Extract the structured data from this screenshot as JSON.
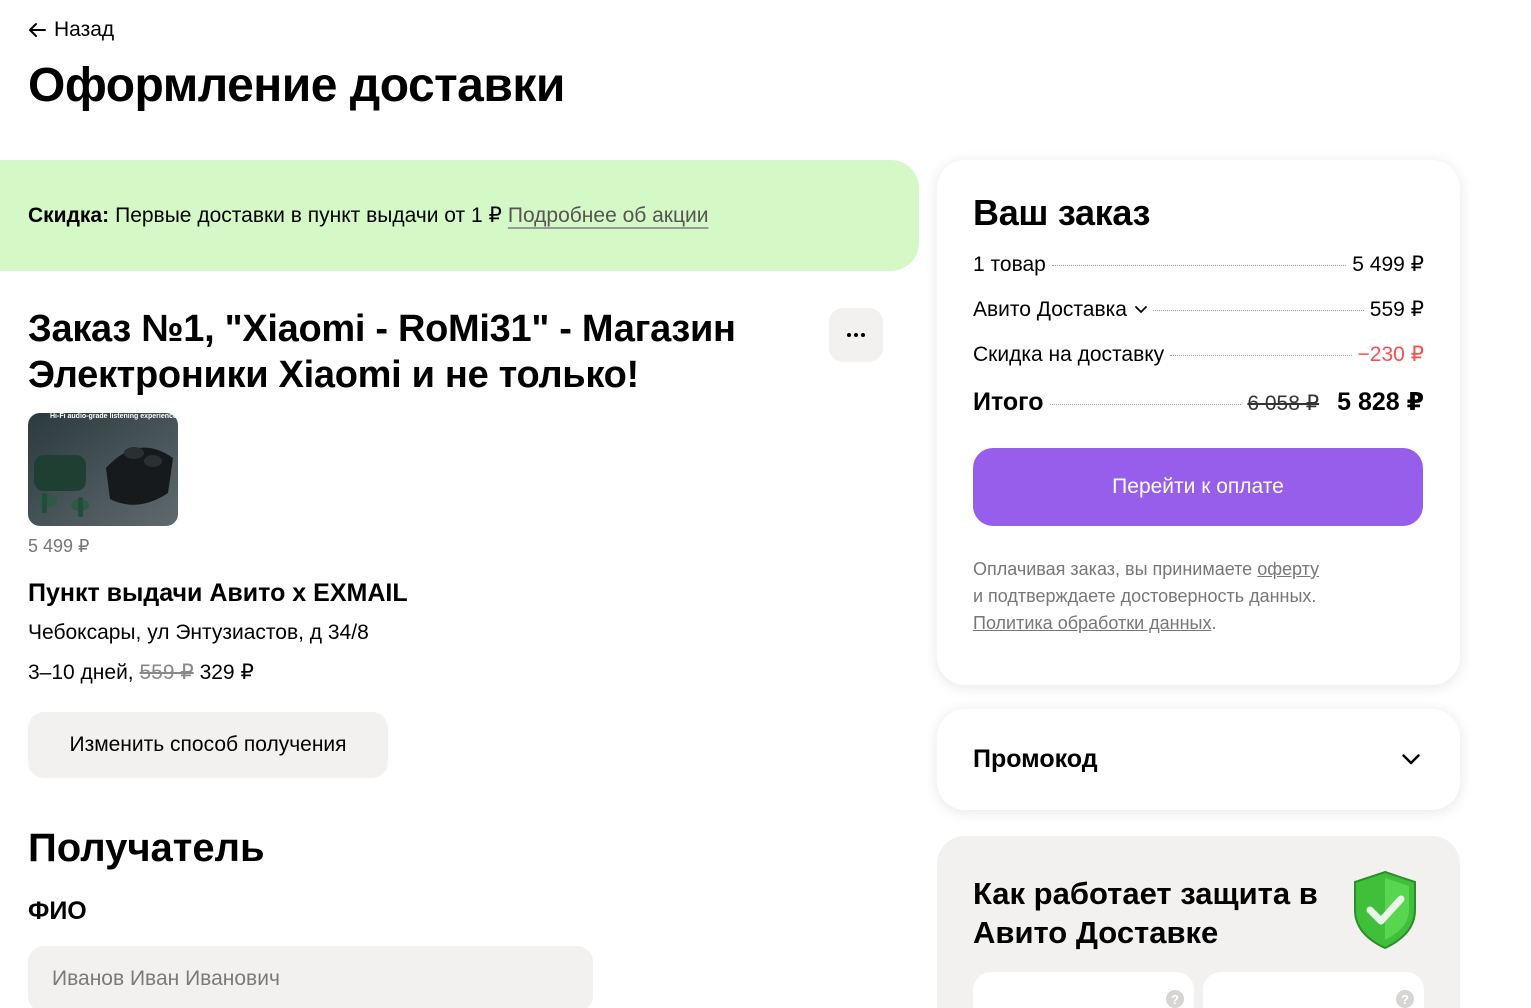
{
  "nav": {
    "back_label": "Назад"
  },
  "page": {
    "title": "Оформление доставки"
  },
  "banner": {
    "label": "Скидка:",
    "text": "Первые доставки в пункт выдачи от 1 ₽",
    "link": "Подробнее об акции",
    "bg_color": "#d4f9c7"
  },
  "order": {
    "title": "Заказ №1, \"Xiaomi - RoMi31\" - Магазин Электроники Xiaomi и не только!",
    "product_image_caption": "Hi-Fi audio-grade listening experience",
    "product_price": "5 499 ₽",
    "pickup": {
      "title": "Пункт выдачи Авито x EXMAIL",
      "address": "Чебоксары, ул Энтузиастов, д 34/8",
      "days": "3–10 дней,",
      "old_price": "559 ₽",
      "new_price": "329 ₽"
    },
    "change_button": "Изменить способ получения"
  },
  "recipient": {
    "title": "Получатель",
    "fio_label": "ФИО",
    "fio_placeholder": "Иванов Иван Иванович",
    "fio_value": ""
  },
  "summary": {
    "title": "Ваш заказ",
    "rows": [
      {
        "label": "1 товар",
        "value": "5 499 ₽"
      },
      {
        "label": "Авито Доставка",
        "value": "559 ₽"
      },
      {
        "label": "Скидка на доставку",
        "value": "−230 ₽"
      }
    ],
    "total_label": "Итого",
    "total_old": "6 058 ₽",
    "total_new": "5 828 ₽",
    "pay_button": "Перейти к оплате",
    "legal_1": "Оплачивая заказ, вы принимаете",
    "legal_offer": "оферту",
    "legal_2": "и подтверждаете достоверность данных.",
    "legal_policy": "Политика обработки данных",
    "legal_end": ".",
    "accent_color": "#965eeb",
    "discount_color": "#ff4d4d"
  },
  "promo": {
    "label": "Промокод"
  },
  "protection": {
    "title": "Как работает защита в Авито Доставке",
    "help_glyph": "?"
  }
}
